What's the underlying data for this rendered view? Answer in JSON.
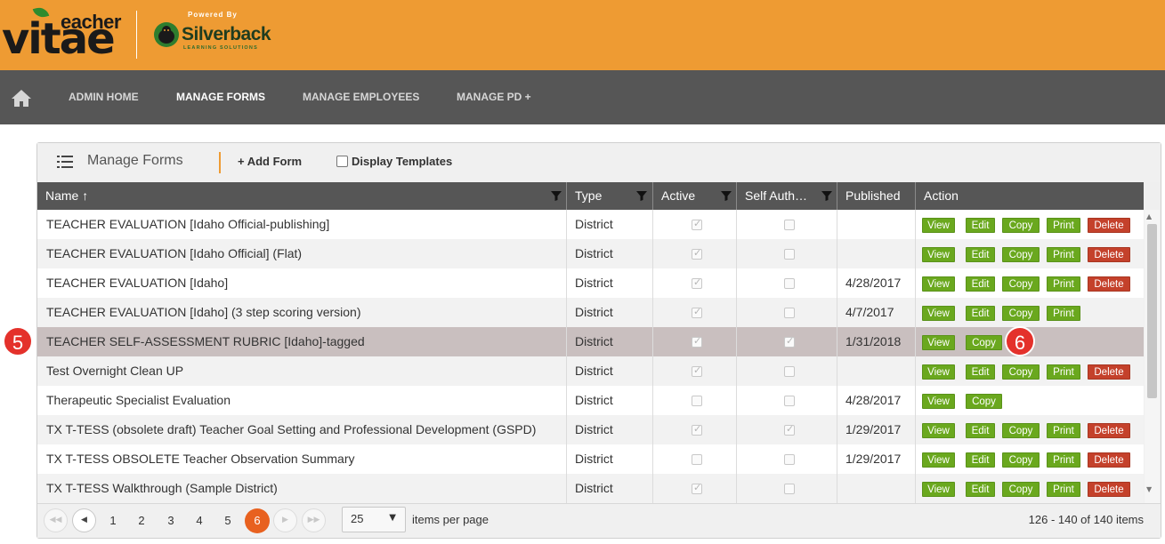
{
  "brand": {
    "logo_teacher": "eacher",
    "logo_vitae": "vitae",
    "powered_by": "Powered By",
    "partner_name": "Silverback",
    "partner_sub": "LEARNING SOLUTIONS"
  },
  "nav": {
    "items": [
      {
        "label": "ADMIN HOME",
        "active": false
      },
      {
        "label": "MANAGE FORMS",
        "active": true
      },
      {
        "label": "MANAGE EMPLOYEES",
        "active": false
      },
      {
        "label": "MANAGE PD +",
        "active": false
      }
    ]
  },
  "panel": {
    "title": "Manage Forms",
    "add_form_label": "+ Add Form",
    "display_templates_label": "Display Templates",
    "display_templates_checked": false
  },
  "grid": {
    "columns": [
      "Name ↑",
      "Type",
      "Active",
      "Self Auth…",
      "Published",
      "Action"
    ],
    "rows": [
      {
        "name": "TEACHER EVALUATION [Idaho Official-publishing]",
        "type": "District",
        "active": true,
        "self_auth": false,
        "published": "",
        "actions": [
          "View",
          "Edit",
          "Copy",
          "Print",
          "Delete"
        ]
      },
      {
        "name": "TEACHER EVALUATION [Idaho Official] (Flat)",
        "type": "District",
        "active": true,
        "self_auth": false,
        "published": "",
        "actions": [
          "View",
          "Edit",
          "Copy",
          "Print",
          "Delete"
        ]
      },
      {
        "name": "TEACHER EVALUATION [Idaho]",
        "type": "District",
        "active": true,
        "self_auth": false,
        "published": "4/28/2017",
        "actions": [
          "View",
          "Edit",
          "Copy",
          "Print",
          "Delete"
        ]
      },
      {
        "name": "TEACHER EVALUATION [Idaho] (3 step scoring version)",
        "type": "District",
        "active": true,
        "self_auth": false,
        "published": "4/7/2017",
        "actions": [
          "View",
          "Edit",
          "Copy",
          "Print"
        ]
      },
      {
        "name": "TEACHER SELF-ASSESSMENT RUBRIC [Idaho]-tagged",
        "type": "District",
        "active": true,
        "self_auth": true,
        "published": "1/31/2018",
        "actions": [
          "View",
          "Copy"
        ],
        "selected": true
      },
      {
        "name": "Test Overnight Clean UP",
        "type": "District",
        "active": true,
        "self_auth": false,
        "published": "",
        "actions": [
          "View",
          "Edit",
          "Copy",
          "Print",
          "Delete"
        ]
      },
      {
        "name": "Therapeutic Specialist Evaluation",
        "type": "District",
        "active": false,
        "self_auth": false,
        "published": "4/28/2017",
        "actions": [
          "View",
          "Copy"
        ]
      },
      {
        "name": "TX T-TESS (obsolete draft) Teacher Goal Setting and Professional Development (GSPD)",
        "type": "District",
        "active": true,
        "self_auth": true,
        "published": "1/29/2017",
        "actions": [
          "View",
          "Edit",
          "Copy",
          "Print",
          "Delete"
        ]
      },
      {
        "name": "TX T-TESS OBSOLETE Teacher Observation Summary",
        "type": "District",
        "active": false,
        "self_auth": false,
        "published": "1/29/2017",
        "actions": [
          "View",
          "Edit",
          "Copy",
          "Print",
          "Delete"
        ]
      },
      {
        "name": "TX T-TESS Walkthrough (Sample District)",
        "type": "District",
        "active": true,
        "self_auth": false,
        "published": "",
        "actions": [
          "View",
          "Edit",
          "Copy",
          "Print",
          "Delete"
        ]
      }
    ]
  },
  "pager": {
    "pages": [
      "1",
      "2",
      "3",
      "4",
      "5",
      "6"
    ],
    "current_page": "6",
    "page_size": "25",
    "items_per_page_label": "items per page",
    "info": "126 - 140 of 140 items"
  },
  "markers": {
    "left": "5",
    "right": "6"
  },
  "colors": {
    "header_orange": "#ee9b33",
    "nav_gray": "#565656",
    "button_green": "#6aa81e",
    "button_red": "#c4412b",
    "current_page": "#e8611f",
    "marker_red": "#e4312b"
  }
}
